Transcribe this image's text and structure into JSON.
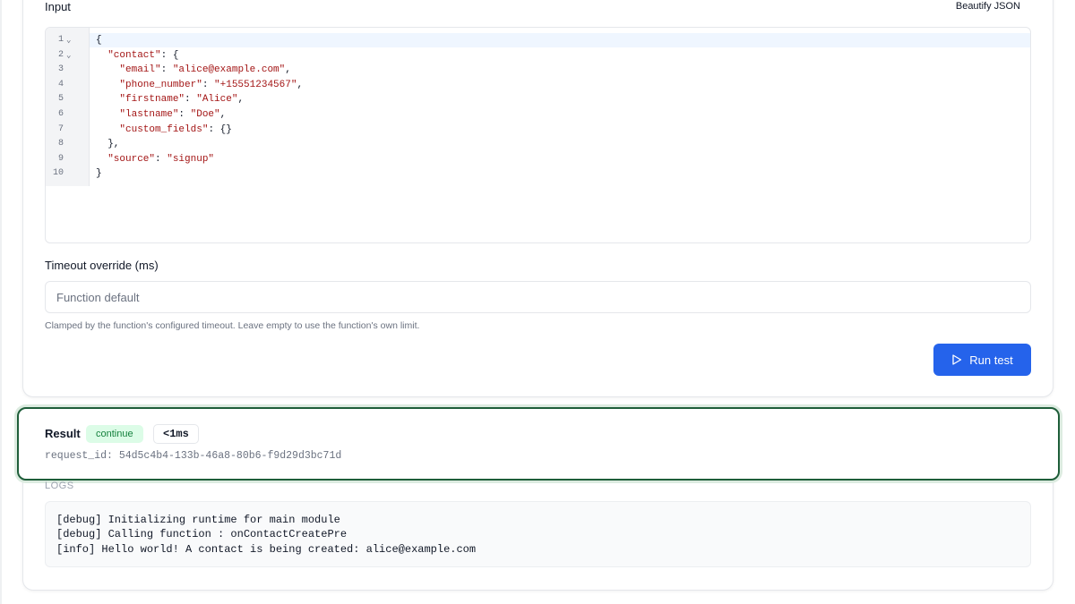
{
  "input": {
    "label": "Input",
    "beautify_label": "Beautify JSON",
    "editor": {
      "lines": [
        {
          "num": "1",
          "fold": "⌄",
          "tokens": [
            {
              "t": "p",
              "v": "{"
            }
          ]
        },
        {
          "num": "2",
          "fold": "⌄",
          "tokens": [
            {
              "t": "p",
              "v": "  "
            },
            {
              "t": "k",
              "v": "\"contact\""
            },
            {
              "t": "p",
              "v": ": {"
            }
          ]
        },
        {
          "num": "3",
          "fold": "",
          "tokens": [
            {
              "t": "p",
              "v": "    "
            },
            {
              "t": "k",
              "v": "\"email\""
            },
            {
              "t": "p",
              "v": ": "
            },
            {
              "t": "s",
              "v": "\"alice@example.com\""
            },
            {
              "t": "p",
              "v": ","
            }
          ]
        },
        {
          "num": "4",
          "fold": "",
          "tokens": [
            {
              "t": "p",
              "v": "    "
            },
            {
              "t": "k",
              "v": "\"phone_number\""
            },
            {
              "t": "p",
              "v": ": "
            },
            {
              "t": "s",
              "v": "\"+15551234567\""
            },
            {
              "t": "p",
              "v": ","
            }
          ]
        },
        {
          "num": "5",
          "fold": "",
          "tokens": [
            {
              "t": "p",
              "v": "    "
            },
            {
              "t": "k",
              "v": "\"firstname\""
            },
            {
              "t": "p",
              "v": ": "
            },
            {
              "t": "s",
              "v": "\"Alice\""
            },
            {
              "t": "p",
              "v": ","
            }
          ]
        },
        {
          "num": "6",
          "fold": "",
          "tokens": [
            {
              "t": "p",
              "v": "    "
            },
            {
              "t": "k",
              "v": "\"lastname\""
            },
            {
              "t": "p",
              "v": ": "
            },
            {
              "t": "s",
              "v": "\"Doe\""
            },
            {
              "t": "p",
              "v": ","
            }
          ]
        },
        {
          "num": "7",
          "fold": "",
          "tokens": [
            {
              "t": "p",
              "v": "    "
            },
            {
              "t": "k",
              "v": "\"custom_fields\""
            },
            {
              "t": "p",
              "v": ": {}"
            }
          ]
        },
        {
          "num": "8",
          "fold": "",
          "tokens": [
            {
              "t": "p",
              "v": "  },"
            }
          ]
        },
        {
          "num": "9",
          "fold": "",
          "tokens": [
            {
              "t": "p",
              "v": "  "
            },
            {
              "t": "k",
              "v": "\"source\""
            },
            {
              "t": "p",
              "v": ": "
            },
            {
              "t": "s",
              "v": "\"signup\""
            }
          ]
        },
        {
          "num": "10",
          "fold": "",
          "tokens": [
            {
              "t": "p",
              "v": "}"
            }
          ]
        }
      ]
    }
  },
  "timeout": {
    "label": "Timeout override (ms)",
    "value": "",
    "placeholder": "Function default",
    "help": "Clamped by the function's configured timeout. Leave empty to use the function's own limit."
  },
  "run_button": {
    "label": "Run test",
    "icon": "play-icon",
    "color": "#2563eb"
  },
  "result": {
    "title": "Result",
    "status_badge": "continue",
    "duration_badge": "<1ms",
    "request_id": "request_id: 54d5c4b4-133b-46a8-80b6-f9d29d3bc71d",
    "status_color": "#15803d"
  },
  "logs": {
    "label": "LOGS",
    "lines": [
      "[debug] Initializing runtime for main module",
      "[debug] Calling function : onContactCreatePre",
      "[info] Hello world! A contact is being created: alice@example.com"
    ]
  }
}
